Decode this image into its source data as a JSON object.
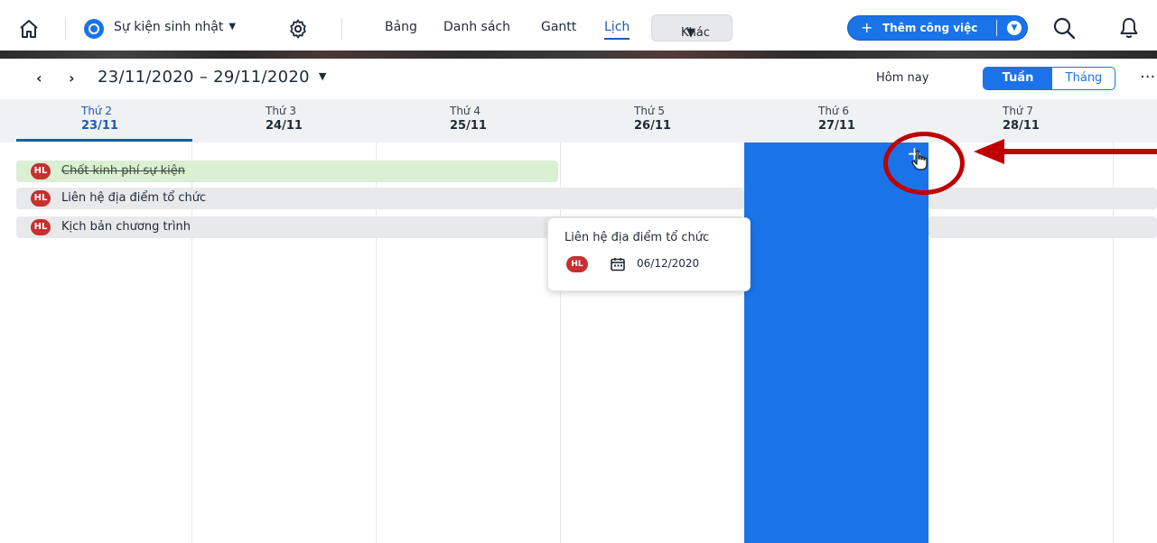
{
  "topbar": {
    "project_title": "Sự kiện sinh nhật",
    "tabs": [
      {
        "label": "Bảng"
      },
      {
        "label": "Danh sách"
      },
      {
        "label": "Gantt"
      },
      {
        "label": "Lịch",
        "active": true
      },
      {
        "label": "Khác"
      }
    ],
    "add_button_label": "Thêm công việc",
    "accent": "#1a73e8"
  },
  "datebar": {
    "range": "23/11/2020 – 29/11/2020",
    "today_label": "Hôm nay",
    "view_week": "Tuần",
    "view_month": "Tháng"
  },
  "days": [
    {
      "name": "Thứ 2",
      "date": "23/11",
      "active": true
    },
    {
      "name": "Thứ 3",
      "date": "24/11"
    },
    {
      "name": "Thứ 4",
      "date": "25/11"
    },
    {
      "name": "Thứ 5",
      "date": "26/11"
    },
    {
      "name": "Thứ 6",
      "date": "27/11"
    },
    {
      "name": "Thứ 7",
      "date": "28/11"
    }
  ],
  "tasks": [
    {
      "avatar": "HL",
      "label": "Chốt kinh phí sự kiện",
      "done": true,
      "color": "#d9f0d3"
    },
    {
      "avatar": "HL",
      "label": "Liên hệ địa điểm tổ chức",
      "done": false,
      "color": "#e8e9eb"
    },
    {
      "avatar": "HL",
      "label": "Kịch bản chương trình",
      "done": false,
      "color": "#e8e9eb"
    }
  ],
  "popover": {
    "title": "Liên hệ địa điểm tổ chức",
    "avatar": "HL",
    "date": "06/12/2020"
  },
  "colors": {
    "highlight_column": "#1a73e8",
    "annotation_red": "#c00000",
    "done_task": "#d9f0d3"
  }
}
